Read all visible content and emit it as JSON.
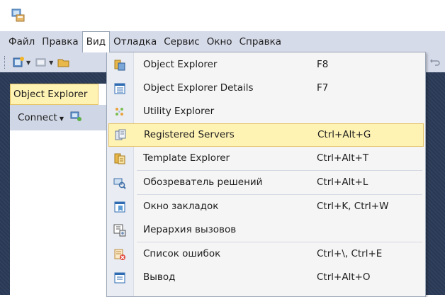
{
  "menubar": {
    "items": [
      {
        "label": "Файл"
      },
      {
        "label": "Правка"
      },
      {
        "label": "Вид"
      },
      {
        "label": "Отладка"
      },
      {
        "label": "Сервис"
      },
      {
        "label": "Окно"
      },
      {
        "label": "Справка"
      }
    ],
    "open_item": "Вид"
  },
  "object_explorer": {
    "tab_label": "Object Explorer",
    "connect_label": "Connect"
  },
  "view_menu": {
    "items": [
      {
        "label": "Object Explorer",
        "shortcut": "F8",
        "icon": "object-explorer-icon"
      },
      {
        "label": "Object Explorer Details",
        "shortcut": "F7",
        "icon": "object-explorer-details-icon"
      },
      {
        "label": "Utility Explorer",
        "shortcut": "",
        "icon": "utility-explorer-icon"
      },
      {
        "label": "Registered Servers",
        "shortcut": "Ctrl+Alt+G",
        "icon": "registered-servers-icon",
        "highlighted": true
      },
      {
        "label": "Template Explorer",
        "shortcut": "Ctrl+Alt+T",
        "icon": "template-explorer-icon"
      },
      {
        "label": "Обозреватель решений",
        "shortcut": "Ctrl+Alt+L",
        "icon": "solution-explorer-icon"
      },
      {
        "label": "Окно закладок",
        "shortcut": "Ctrl+K, Ctrl+W",
        "icon": "bookmarks-window-icon"
      },
      {
        "label": "Иерархия вызовов",
        "shortcut": "",
        "icon": "call-hierarchy-icon"
      },
      {
        "label": "Список ошибок",
        "shortcut": "Ctrl+\\, Ctrl+E",
        "icon": "error-list-icon"
      },
      {
        "label": "Вывод",
        "shortcut": "Ctrl+Alt+O",
        "icon": "output-icon"
      }
    ]
  },
  "colors": {
    "menubar_bg": "#d6dbe9",
    "workspace_bg": "#293955",
    "highlight_bg": "#fff3b4",
    "highlight_border": "#e5c365"
  }
}
